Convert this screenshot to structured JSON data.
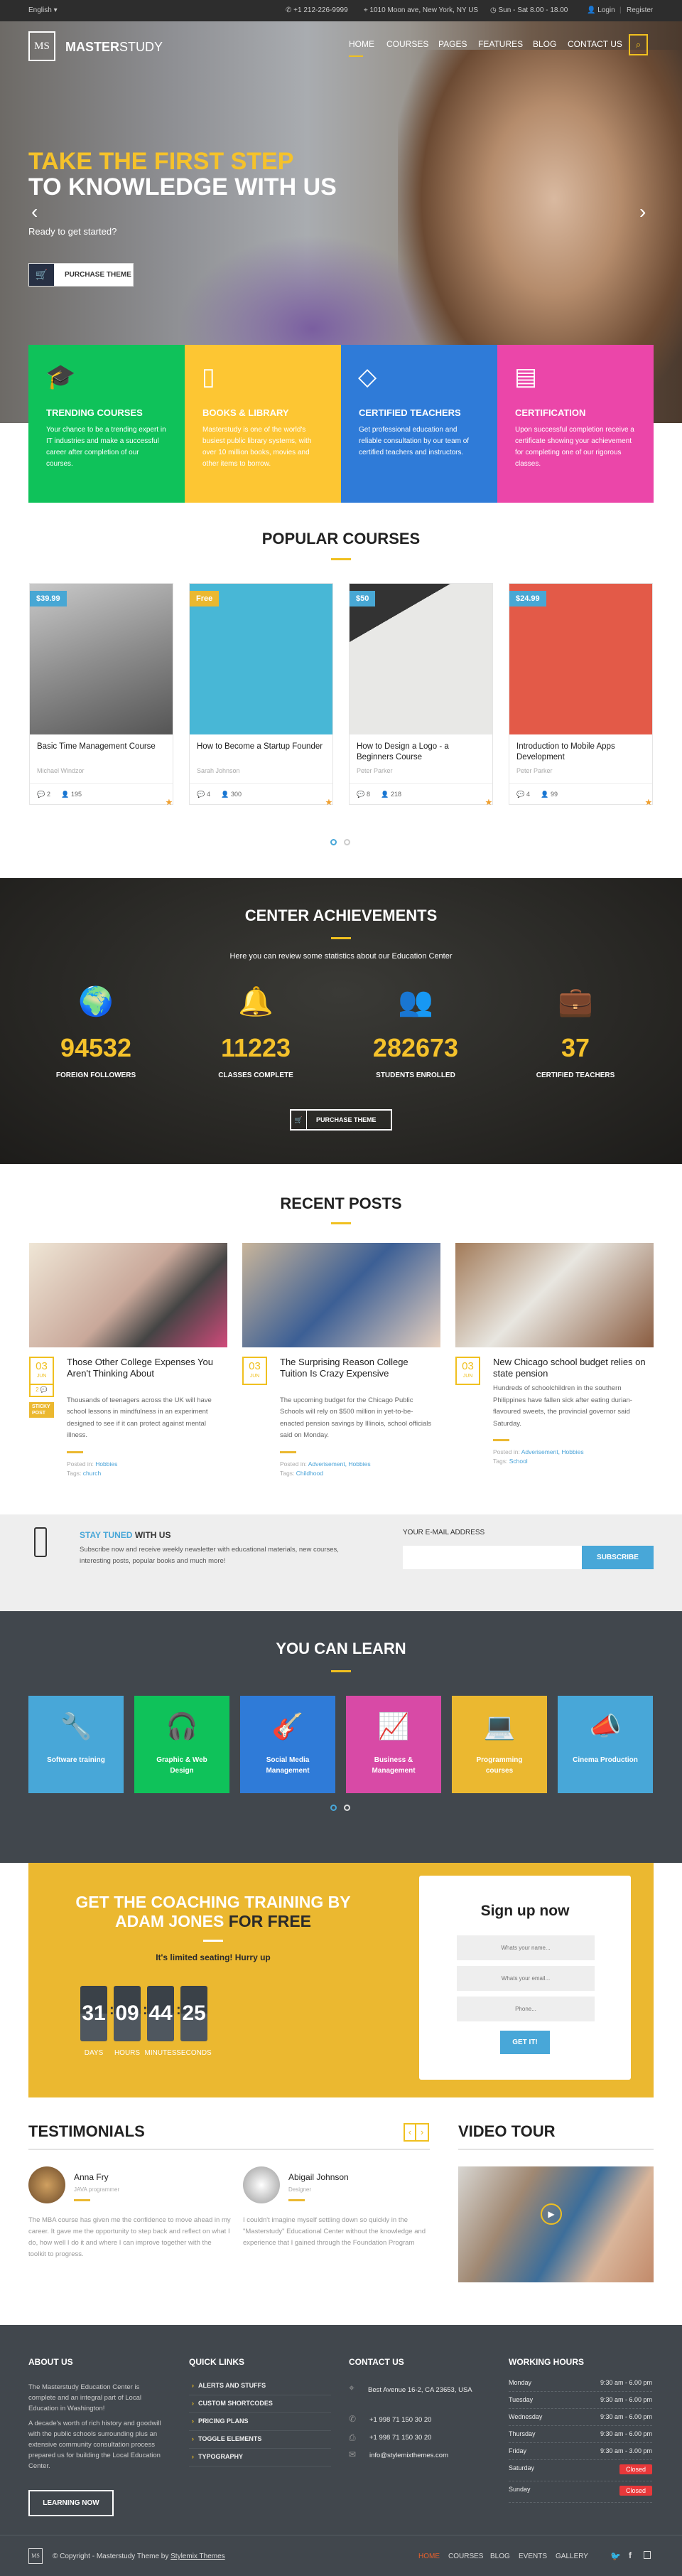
{
  "topbar": {
    "language": "English",
    "phone": "+1 212-226-9999",
    "address": "1010 Moon ave, New York, NY US",
    "hours": "Sun - Sat 8.00 - 18.00",
    "login": "Login",
    "register": "Register"
  },
  "header": {
    "logo_mark": "MS",
    "logo_bold": "MASTER",
    "logo_light": "STUDY",
    "nav": [
      "HOME",
      "COURSES",
      "PAGES",
      "FEATURES",
      "BLOG",
      "CONTACT US"
    ],
    "active_nav": "HOME",
    "accent": "#f0c020"
  },
  "hero": {
    "title_line1": "TAKE THE FIRST STEP",
    "title_line2": "TO KNOWLEDGE WITH US",
    "subtitle": "Ready to get started?",
    "button": "PURCHASE THEME"
  },
  "features": [
    {
      "title": "TRENDING COURSES",
      "text": "Your chance to be a trending expert in IT industries and make a successful career after completion of our courses.",
      "color": "#0fc25a",
      "icon": "graduation-cap-icon"
    },
    {
      "title": "BOOKS & LIBRARY",
      "text": "Masterstudy is one of the world's busiest public library systems, with over 10 million books, movies and other items to borrow.",
      "color": "#fdc633",
      "icon": "book-icon"
    },
    {
      "title": "CERTIFIED TEACHERS",
      "text": "Get professional education and reliable consultation by our team of certified teachers and instructors.",
      "color": "#2f7bd8",
      "icon": "diamond-icon"
    },
    {
      "title": "CERTIFICATION",
      "text": "Upon successful completion receive a certificate showing your achievement for completing one of our rigorous classes.",
      "color": "#eb46a9",
      "icon": "certificate-icon"
    }
  ],
  "popular": {
    "title": "POPULAR COURSES",
    "courses": [
      {
        "price": "$39.99",
        "price_color": "#48a7d4",
        "title": "Basic Time Management Course",
        "author": "Michael Windzor",
        "comments": "2",
        "students": "195",
        "rating": 5
      },
      {
        "price": "Free",
        "price_color": "#eab830",
        "title": "How to Become a Startup Founder",
        "author": "Sarah Johnson",
        "comments": "4",
        "students": "300",
        "rating": 5
      },
      {
        "price": "$50",
        "price_color": "#48a7d4",
        "title": "How to Design a Logo - a Beginners Course",
        "author": "Peter Parker",
        "comments": "8",
        "students": "218",
        "rating": 4
      },
      {
        "price": "$24.99",
        "price_color": "#48a7d4",
        "title": "Introduction to Mobile Apps Development",
        "author": "Peter Parker",
        "comments": "4",
        "students": "99",
        "rating": 4
      }
    ]
  },
  "achievements": {
    "title": "CENTER ACHIEVEMENTS",
    "subtitle": "Here you can review some statistics about our Education Center",
    "stats": [
      {
        "value": "94532",
        "label": "FOREIGN FOLLOWERS",
        "icon": "globe-icon"
      },
      {
        "value": "11223",
        "label": "CLASSES COMPLETE",
        "icon": "bell-icon"
      },
      {
        "value": "282673",
        "label": "STUDENTS ENROLLED",
        "icon": "users-icon"
      },
      {
        "value": "37",
        "label": "CERTIFIED TEACHERS",
        "icon": "briefcase-icon"
      }
    ],
    "button": "PURCHASE THEME"
  },
  "recent": {
    "title": "RECENT POSTS",
    "posts": [
      {
        "day": "03",
        "month": "JUN",
        "comments": "2",
        "sticky": "STICKY POST",
        "title": "Those Other College Expenses You Aren't Thinking About",
        "body": "Thousands of teenagers across the UK will have school lessons in mindfulness in an experiment designed to see if it can protect against mental illness.",
        "posted_label": "Posted in:",
        "categories": "Hobbies",
        "tags_label": "Tags:",
        "tags": "church"
      },
      {
        "day": "03",
        "month": "JUN",
        "title": "The Surprising Reason College Tuition Is Crazy Expensive",
        "body": "The upcoming budget for the Chicago Public Schools will rely on $500 million in yet-to-be-enacted pension savings by Illinois, school officials said on Monday.",
        "posted_label": "Posted in:",
        "categories": "Adverisement, Hobbies",
        "tags_label": "Tags:",
        "tags": "Childhood"
      },
      {
        "day": "03",
        "month": "JUN",
        "title": "New Chicago school budget relies on state pension",
        "body": "Hundreds of schoolchildren in the southern Philippines have fallen sick after eating durian-flavoured sweets, the provincial governor said Saturday.",
        "posted_label": "Posted in:",
        "categories": "Adverisement, Hobbies",
        "tags_label": "Tags:",
        "tags": "School"
      }
    ]
  },
  "newsletter": {
    "title_accent": "STAY TUNED",
    "title_rest": "WITH US",
    "text": "Subscribe now and receive weekly newsletter with educational materials, new courses, interesting posts, popular books and much more!",
    "email_label": "YOUR E-MAIL ADDRESS",
    "email_value": "",
    "button": "SUBSCRIBE"
  },
  "learn": {
    "title": "YOU CAN LEARN",
    "items": [
      {
        "label": "Software training",
        "color": "#48a7d8",
        "icon": "wrench-icon"
      },
      {
        "label": "Graphic & Web Design",
        "color": "#0fc25a",
        "icon": "headphones-icon"
      },
      {
        "label": "Social Media Management",
        "color": "#2f7bd8",
        "icon": "guitar-icon"
      },
      {
        "label": "Business & Management",
        "color": "#d84aa6",
        "icon": "area-chart-icon"
      },
      {
        "label": "Programming courses",
        "color": "#ebb830",
        "icon": "laptop-icon"
      },
      {
        "label": "Cinema Production",
        "color": "#48a7d8",
        "icon": "megaphone-icon"
      }
    ]
  },
  "coaching": {
    "title_white": "GET THE COACHING TRAINING BY ADAM JONES",
    "title_dark": "FOR FREE",
    "subtitle": "It's limited seating! Hurry up",
    "countdown": [
      {
        "value": "31",
        "label": "DAYS"
      },
      {
        "value": "09",
        "label": "HOURS"
      },
      {
        "value": "44",
        "label": "MINUTES"
      },
      {
        "value": "25",
        "label": "SECONDS"
      }
    ],
    "form": {
      "title": "Sign up now",
      "name_placeholder": "Whats your name...",
      "email_placeholder": "Whats your email...",
      "phone_placeholder": "Phone...",
      "button": "GET IT!"
    }
  },
  "testimonials": {
    "title": "TESTIMONIALS",
    "items": [
      {
        "name": "Anna Fry",
        "role": "JAVA programmer",
        "text": "The MBA course has given me the confidence to move ahead in my career. It gave me the opportunity to step back and reflect on what I do, how well I do it and where I can improve together with the toolkit to progress."
      },
      {
        "name": "Abigail Johnson",
        "role": "Designer",
        "text": "I couldn't imagine myself settling down so quickly in the \"Masterstudy\" Educational Center without the knowledge and experience that I gained through the Foundation Program"
      }
    ]
  },
  "video": {
    "title": "VIDEO TOUR"
  },
  "footer": {
    "about": {
      "title": "ABOUT US",
      "p1": "The Masterstudy Education Center is complete and an integral part of Local Education in Washington!",
      "p2": "A decade's worth of rich history and goodwill with the public schools surrounding plus an extensive community consultation process prepared us for building the Local Education Center.",
      "button": "LEARNING NOW"
    },
    "links": {
      "title": "QUICK LINKS",
      "items": [
        "ALERTS AND STUFFS",
        "CUSTOM SHORTCODES",
        "PRICING PLANS",
        "TOGGLE ELEMENTS",
        "TYPOGRAPHY"
      ]
    },
    "contact": {
      "title": "CONTACT US",
      "address": "Best Avenue 16-2, CA 23653, USA",
      "phone": "+1 998 71 150 30 20",
      "fax": "+1 998 71 150 30 20",
      "email": "info@stylemixthemes.com"
    },
    "hours": {
      "title": "WORKING HOURS",
      "rows": [
        {
          "day": "Monday",
          "time": "9:30 am - 6.00 pm"
        },
        {
          "day": "Tuesday",
          "time": "9:30 am - 6.00 pm"
        },
        {
          "day": "Wednesday",
          "time": "9:30 am - 6.00 pm"
        },
        {
          "day": "Thursday",
          "time": "9:30 am - 6.00 pm"
        },
        {
          "day": "Friday",
          "time": "9:30 am - 3.00 pm"
        },
        {
          "day": "Saturday",
          "time": "Closed"
        },
        {
          "day": "Sunday",
          "time": "Closed"
        }
      ]
    },
    "copyright": "© Copyright - Masterstudy Theme by",
    "copyright_link": "Stylemix Themes",
    "bottom_nav": [
      "HOME",
      "COURSES",
      "BLOG",
      "EVENTS",
      "GALLERY"
    ],
    "bottom_active_color": "#e8602c"
  }
}
